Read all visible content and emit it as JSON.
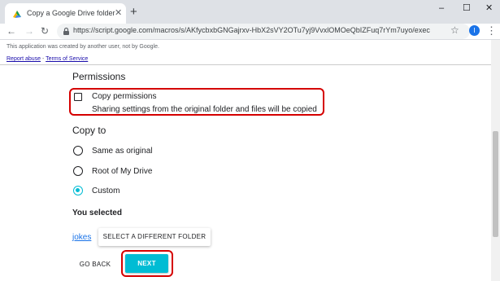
{
  "browser": {
    "tab_title": "Copy a Google Drive folder",
    "tab_close": "✕",
    "new_tab": "+",
    "window_controls": {
      "minimize": "–",
      "maximize": "☐",
      "close": "✕"
    },
    "nav": {
      "back": "←",
      "forward": "→",
      "reload": "↻"
    },
    "url": "https://script.google.com/macros/s/AKfycbxbGNGajrxv-HbX2sVY2OTu7yj9VvxlOMOeQbIZFuq7rYm7uyo/exec",
    "bookmark_star": "☆",
    "profile_initial": "I",
    "menu": "⋮"
  },
  "notice": {
    "text": "This application was created by another user, not by Google.",
    "report_abuse": "Report abuse",
    "separator": " - ",
    "terms": "Terms of Service"
  },
  "permissions": {
    "heading": "Permissions",
    "checkbox_label": "Copy permissions",
    "checkbox_checked": false,
    "description": "Sharing settings from the original folder and files will be copied"
  },
  "copy_to": {
    "heading": "Copy to",
    "options": [
      {
        "label": "Same as original",
        "selected": false
      },
      {
        "label": "Root of My Drive",
        "selected": false
      },
      {
        "label": "Custom",
        "selected": true
      }
    ]
  },
  "selection": {
    "heading": "You selected",
    "folder_name": "jokes",
    "change_button": "SELECT A DIFFERENT FOLDER"
  },
  "actions": {
    "back": "GO BACK",
    "next": "NEXT"
  },
  "colors": {
    "accent": "#00bcd4",
    "highlight": "#d50000",
    "link": "#1a73e8"
  }
}
